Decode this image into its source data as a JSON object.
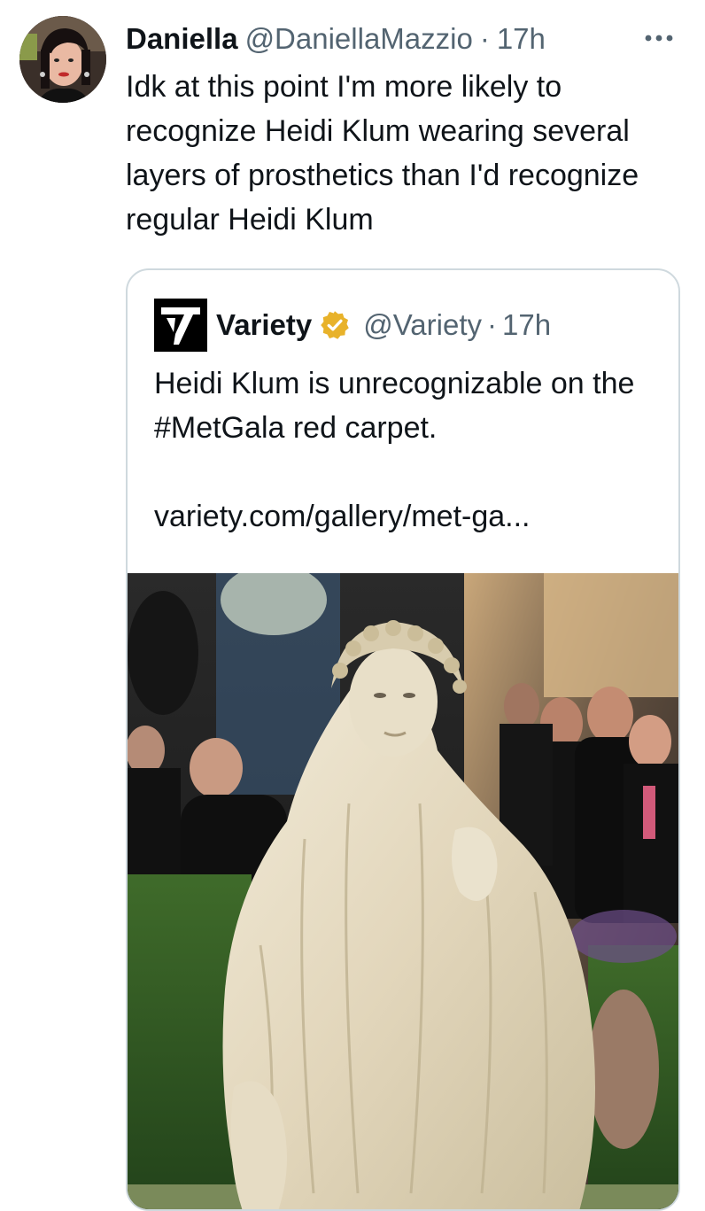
{
  "tweet": {
    "display_name": "Daniella",
    "handle": "@DaniellaMazzio",
    "separator": "·",
    "time": "17h",
    "text": "Idk at this point I'm more likely to recognize Heidi Klum wearing several layers of prosthetics than I'd recognize regular Heidi Klum",
    "more_icon": "more-horizontal-icon"
  },
  "quote": {
    "display_name": "Variety",
    "handle": "@Variety",
    "separator": "·",
    "time": "17h",
    "verified_icon": "verified-badge-icon",
    "verified_color": "#e8b22a",
    "logo_letter": "V",
    "text": "Heidi Klum is unrecognizable on the #MetGala red carpet.",
    "link": "variety.com/gallery/met-ga..."
  },
  "colors": {
    "text_primary": "#0f1419",
    "text_secondary": "#536471",
    "border": "#cfd9de"
  }
}
